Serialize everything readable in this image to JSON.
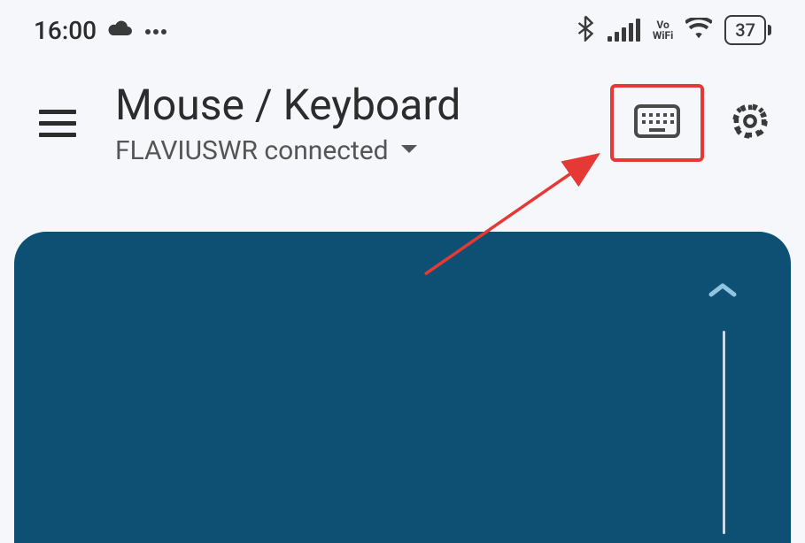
{
  "statusbar": {
    "time": "16:00",
    "battery_level": "37",
    "vowifi_top": "Vo",
    "vowifi_bottom": "WiFi"
  },
  "header": {
    "title": "Mouse / Keyboard",
    "connection_status": "FLAVIUSWR connected"
  }
}
